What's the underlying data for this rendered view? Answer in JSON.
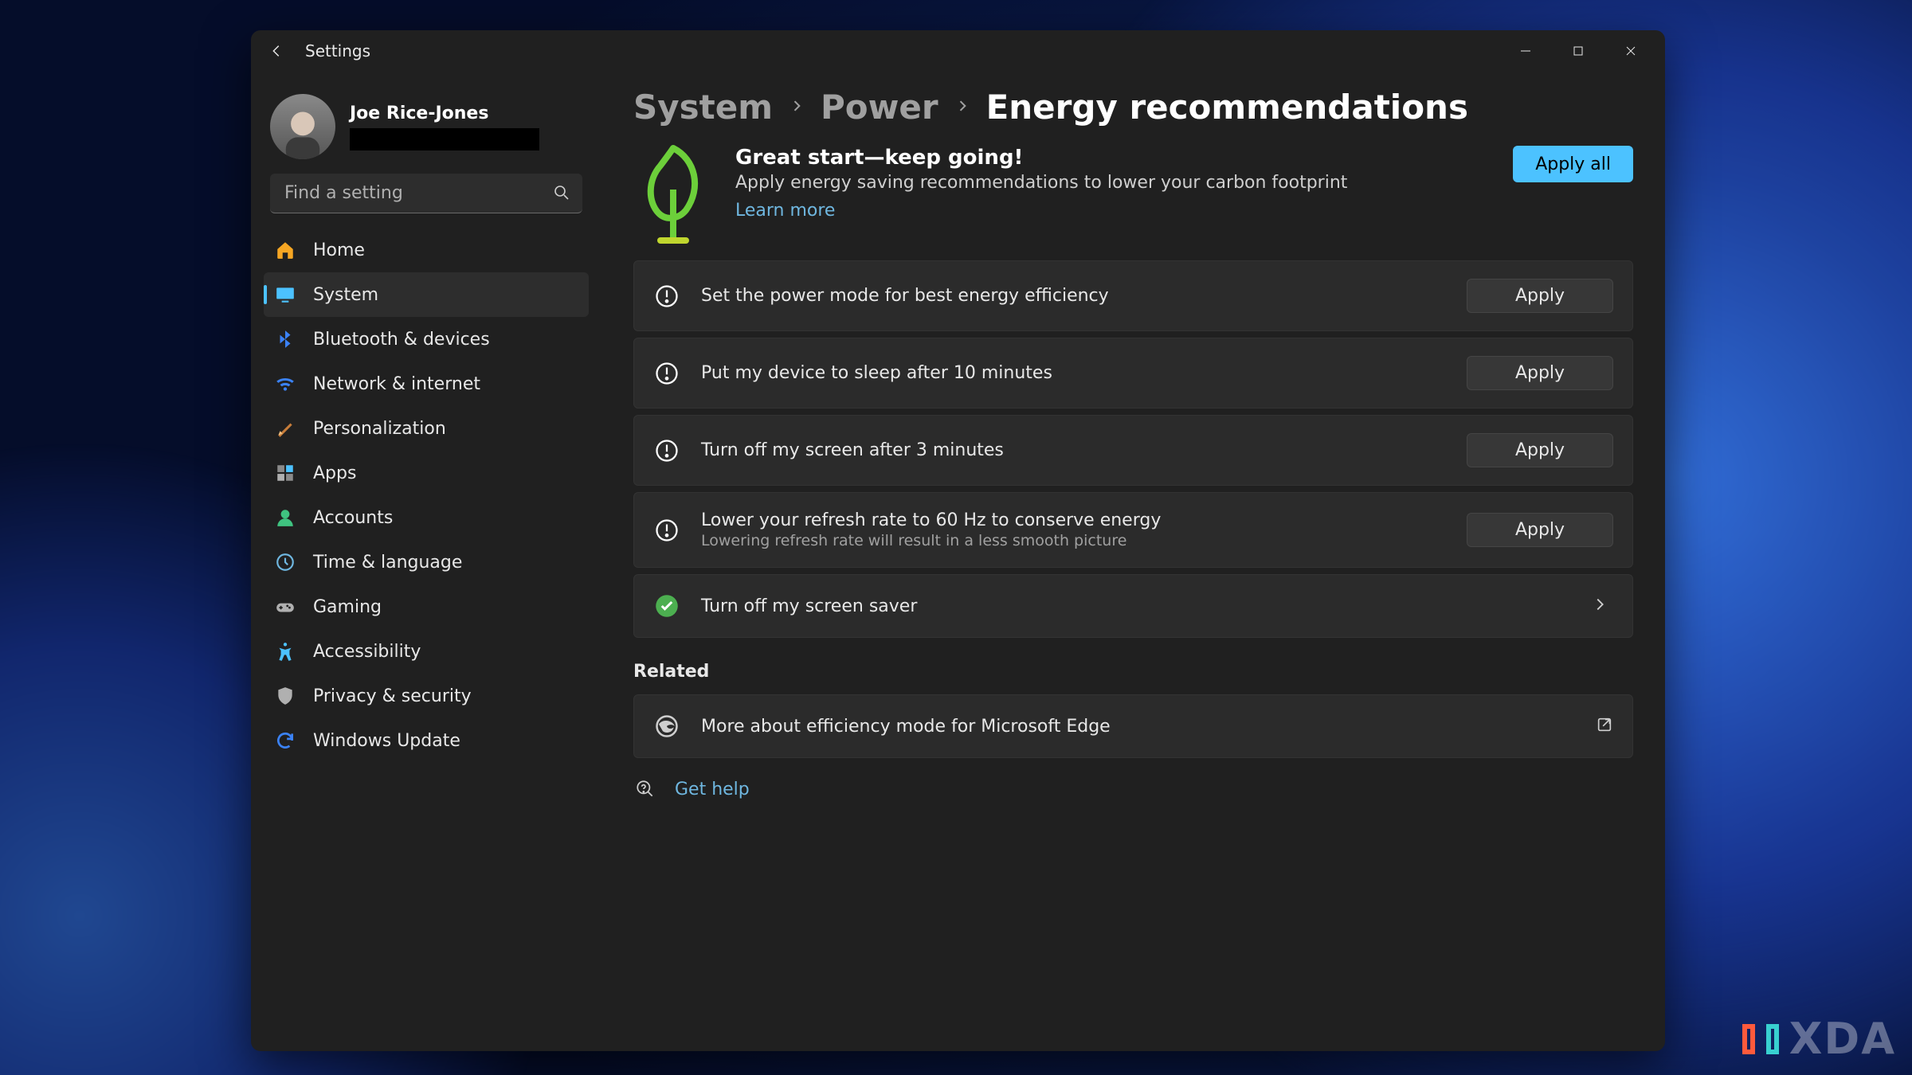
{
  "window": {
    "title": "Settings"
  },
  "user": {
    "name": "Joe Rice-Jones"
  },
  "search": {
    "placeholder": "Find a setting"
  },
  "nav": [
    {
      "icon": "home",
      "label": "Home",
      "active": false
    },
    {
      "icon": "system",
      "label": "System",
      "active": true
    },
    {
      "icon": "bt",
      "label": "Bluetooth & devices",
      "active": false
    },
    {
      "icon": "wifi",
      "label": "Network & internet",
      "active": false
    },
    {
      "icon": "personal",
      "label": "Personalization",
      "active": false
    },
    {
      "icon": "apps",
      "label": "Apps",
      "active": false
    },
    {
      "icon": "accounts",
      "label": "Accounts",
      "active": false
    },
    {
      "icon": "time",
      "label": "Time & language",
      "active": false
    },
    {
      "icon": "gaming",
      "label": "Gaming",
      "active": false
    },
    {
      "icon": "access",
      "label": "Accessibility",
      "active": false
    },
    {
      "icon": "privacy",
      "label": "Privacy & security",
      "active": false
    },
    {
      "icon": "update",
      "label": "Windows Update",
      "active": false
    }
  ],
  "breadcrumb": {
    "level0": "System",
    "level1": "Power",
    "level2": "Energy recommendations"
  },
  "hero": {
    "title": "Great start—keep going!",
    "subtitle": "Apply energy saving recommendations to lower your carbon footprint",
    "learn_more": "Learn more",
    "apply_all": "Apply all"
  },
  "cards": [
    {
      "status": "warn",
      "title": "Set the power mode for best energy efficiency",
      "sub": "",
      "action": "apply",
      "apply_label": "Apply"
    },
    {
      "status": "warn",
      "title": "Put my device to sleep after 10 minutes",
      "sub": "",
      "action": "apply",
      "apply_label": "Apply"
    },
    {
      "status": "warn",
      "title": "Turn off my screen after 3 minutes",
      "sub": "",
      "action": "apply",
      "apply_label": "Apply"
    },
    {
      "status": "warn",
      "title": "Lower your refresh rate to 60 Hz to conserve energy",
      "sub": "Lowering refresh rate will result in a less smooth picture",
      "action": "apply",
      "apply_label": "Apply"
    },
    {
      "status": "done",
      "title": "Turn off my screen saver",
      "sub": "",
      "action": "chevron"
    }
  ],
  "related": {
    "heading": "Related",
    "items": [
      {
        "icon": "edge",
        "title": "More about efficiency mode for Microsoft Edge",
        "action": "external"
      }
    ]
  },
  "help": {
    "label": "Get help"
  },
  "watermark": "XDA"
}
